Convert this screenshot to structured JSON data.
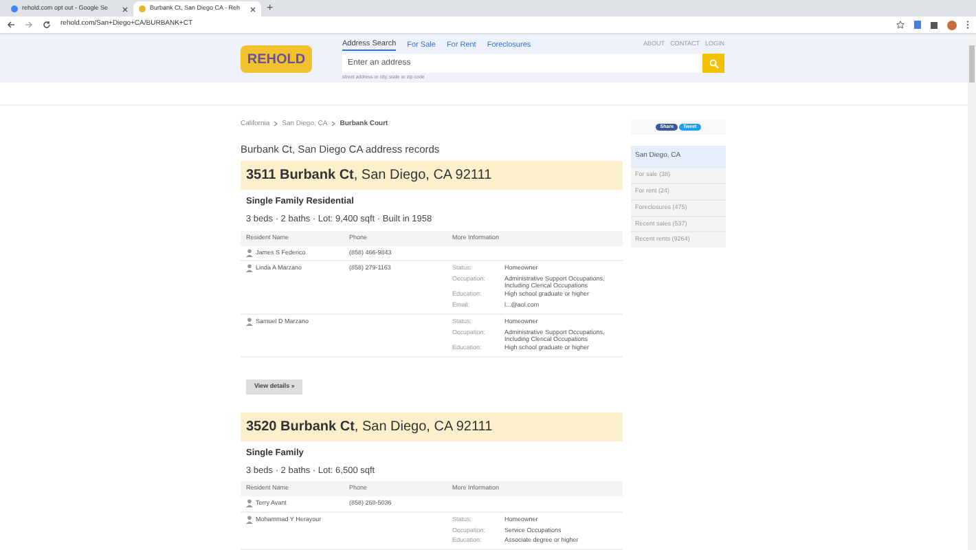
{
  "browser": {
    "tabs": [
      {
        "title": "rehold.com opt out - Google Se",
        "selected": false
      },
      {
        "title": "Burbank Ct, San Diego CA - Reh",
        "selected": true
      }
    ],
    "new_tab": "+",
    "url": "rehold.com/San+Diego+CA/BURBANK+CT"
  },
  "header": {
    "logo": "REHOLD",
    "nav": [
      {
        "label": "Address Search",
        "selected": true
      },
      {
        "label": "For Sale",
        "selected": false
      },
      {
        "label": "For Rent",
        "selected": false
      },
      {
        "label": "Foreclosures",
        "selected": false
      }
    ],
    "links": [
      "ABOUT",
      "CONTACT",
      "LOGIN"
    ],
    "search": {
      "placeholder": "Enter an address",
      "hint": "street address or city, state or zip code"
    }
  },
  "breadcrumb": [
    "California",
    "San Diego, CA",
    "Burbank Court"
  ],
  "heading": "Burbank Ct, San Diego CA address records",
  "records": [
    {
      "address": "**3511 Burbank Ct**, San Diego, CA 92111",
      "type": "Single Family Residential",
      "stats": "3 beds · 2 baths · Lot: 9,400 sqft · Built in 1958",
      "columns": [
        "Resident Name",
        "Phone",
        "More Information"
      ],
      "residents": [
        {
          "name": "James S Federico",
          "phone": "(858) 466-9843"
        },
        {
          "name": "Linda A Marzano",
          "phone": "(858) 279-1163",
          "info": [
            {
              "label": "Status:",
              "value": "Homeowner"
            },
            {
              "label": "Occupation:",
              "value": "Administrative Support Occupations, Including Clerical Occupations"
            },
            {
              "label": "Education:",
              "value": "High school graduate or higher"
            },
            {
              "label": "Email:",
              "value": "l...@aol.com"
            }
          ]
        },
        {
          "name": "Samuel D Marzano",
          "info": [
            {
              "label": "Status:",
              "value": "Homeowner"
            },
            {
              "label": "Occupation:",
              "value": "Administrative Support Occupations, Including Clerical Occupations"
            },
            {
              "label": "Education:",
              "value": "High school graduate or higher"
            }
          ]
        }
      ],
      "details_button": "View details »"
    },
    {
      "address": "**3520 Burbank Ct**, San Diego, CA 92111",
      "type": "Single Family",
      "stats": "3 beds · 2 baths · Lot: 6,500 sqft",
      "columns": [
        "Resident Name",
        "Phone",
        "More Information"
      ],
      "residents": [
        {
          "name": "Terry Avant",
          "phone": "(858) 268-5036"
        },
        {
          "name": "Mohammad Y Herayour",
          "info": [
            {
              "label": "Status:",
              "value": "Homeowner"
            },
            {
              "label": "Occupation:",
              "value": "Service Occupations"
            },
            {
              "label": "Education:",
              "value": "Associate degree or higher"
            }
          ]
        }
      ]
    }
  ],
  "share": [
    "Share",
    "Tweet"
  ],
  "sidebar": {
    "title": "San Diego, CA",
    "items": [
      "For sale (38)",
      "For rent (24)",
      "Foreclosures (475)",
      "Recent sales (537)",
      "Recent rents (9264)"
    ]
  }
}
